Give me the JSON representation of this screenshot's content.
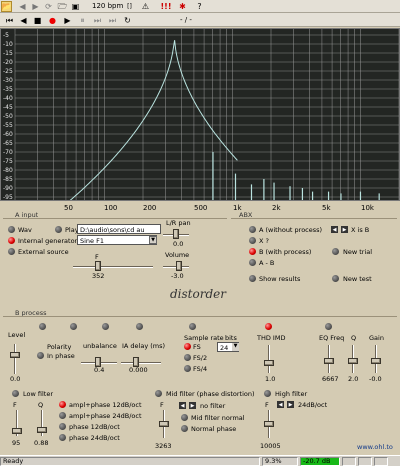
{
  "toolbar": {
    "bpm": "120 bpm",
    "hold_glyph": "[]",
    "alert_glyph": "!!!"
  },
  "position_display": "- / -",
  "graph": {
    "y_ticks": [
      "-5",
      "-10",
      "-15",
      "-20",
      "-25",
      "-30",
      "-35",
      "-40",
      "-45",
      "-50",
      "-55",
      "-60",
      "-65",
      "-70",
      "-75",
      "-80",
      "-85",
      "-90",
      "-95"
    ],
    "x_ticks": [
      "50",
      "100",
      "200",
      "500",
      "1k",
      "2k",
      "5k",
      "10k"
    ]
  },
  "a_input": {
    "title": "A input",
    "wav": "Wav",
    "play": "Play",
    "file": "D:\\audio\\sons\\cd au",
    "internal": "Internal generator",
    "generator": "Sine F1",
    "external": "External source",
    "lr_pan": "L/R pan",
    "pan_val": "0.0",
    "volume": "Volume",
    "volume_val": "-3.0",
    "f_label": "F",
    "f_val": "352"
  },
  "abx": {
    "title": "ABX",
    "a": "A (without process)",
    "x": "X ?",
    "b": "B (with process)",
    "ab": "A - B",
    "xisb": "X is B",
    "new_trial": "New trial",
    "show": "Show results",
    "new_test": "New test"
  },
  "brand": "distorder",
  "b_process": {
    "title": "B process",
    "level": "Level",
    "level_val": "0.0",
    "polarity": "Polarity",
    "in_phase": "In phase",
    "unbalance": "unbalance",
    "unbalance_val": "0.4",
    "ia_delay": "IA delay (ms)",
    "ia_val": "0.000",
    "sample_rate": "Sample rate",
    "bits": "bits",
    "bits_val": "24",
    "fs": "FS",
    "fs2": "FS/2",
    "fs4": "FS/4",
    "thd": "THD IMD",
    "thd_val": "1.0",
    "eq": "EQ Freq",
    "eq_val": "6667",
    "q": "Q",
    "q_val": "2.0",
    "gain": "Gain",
    "gain_val": "-0.0"
  },
  "low_filter": {
    "title": "Low filter",
    "f": "F",
    "q": "Q",
    "f_val": "95",
    "q_val": "0.88",
    "opts": [
      "ampl+phase 12dB/oct",
      "ampl+phase 24dB/oct",
      "phase 12dB/oct",
      "phase 24dB/oct"
    ]
  },
  "mid_filter": {
    "title": "Mid filter (phase distortion)",
    "f": "F",
    "f_val": "3263",
    "opts": [
      "no filter",
      "Mid filter normal",
      "Normal phase"
    ]
  },
  "high_filter": {
    "title": "High filter",
    "slope": "24dB/oct",
    "f": "F",
    "f_val": "10005"
  },
  "url": "www.ohl.to",
  "status": {
    "ready": "Ready",
    "pct": "9.3%",
    "db": "-20.7 dB"
  },
  "colors": {
    "graph_bg": "#232623",
    "curve": "#b9e3df",
    "grid": "#cfcfcf",
    "led_on": "#dd0000",
    "meter_green": "#18b818"
  }
}
